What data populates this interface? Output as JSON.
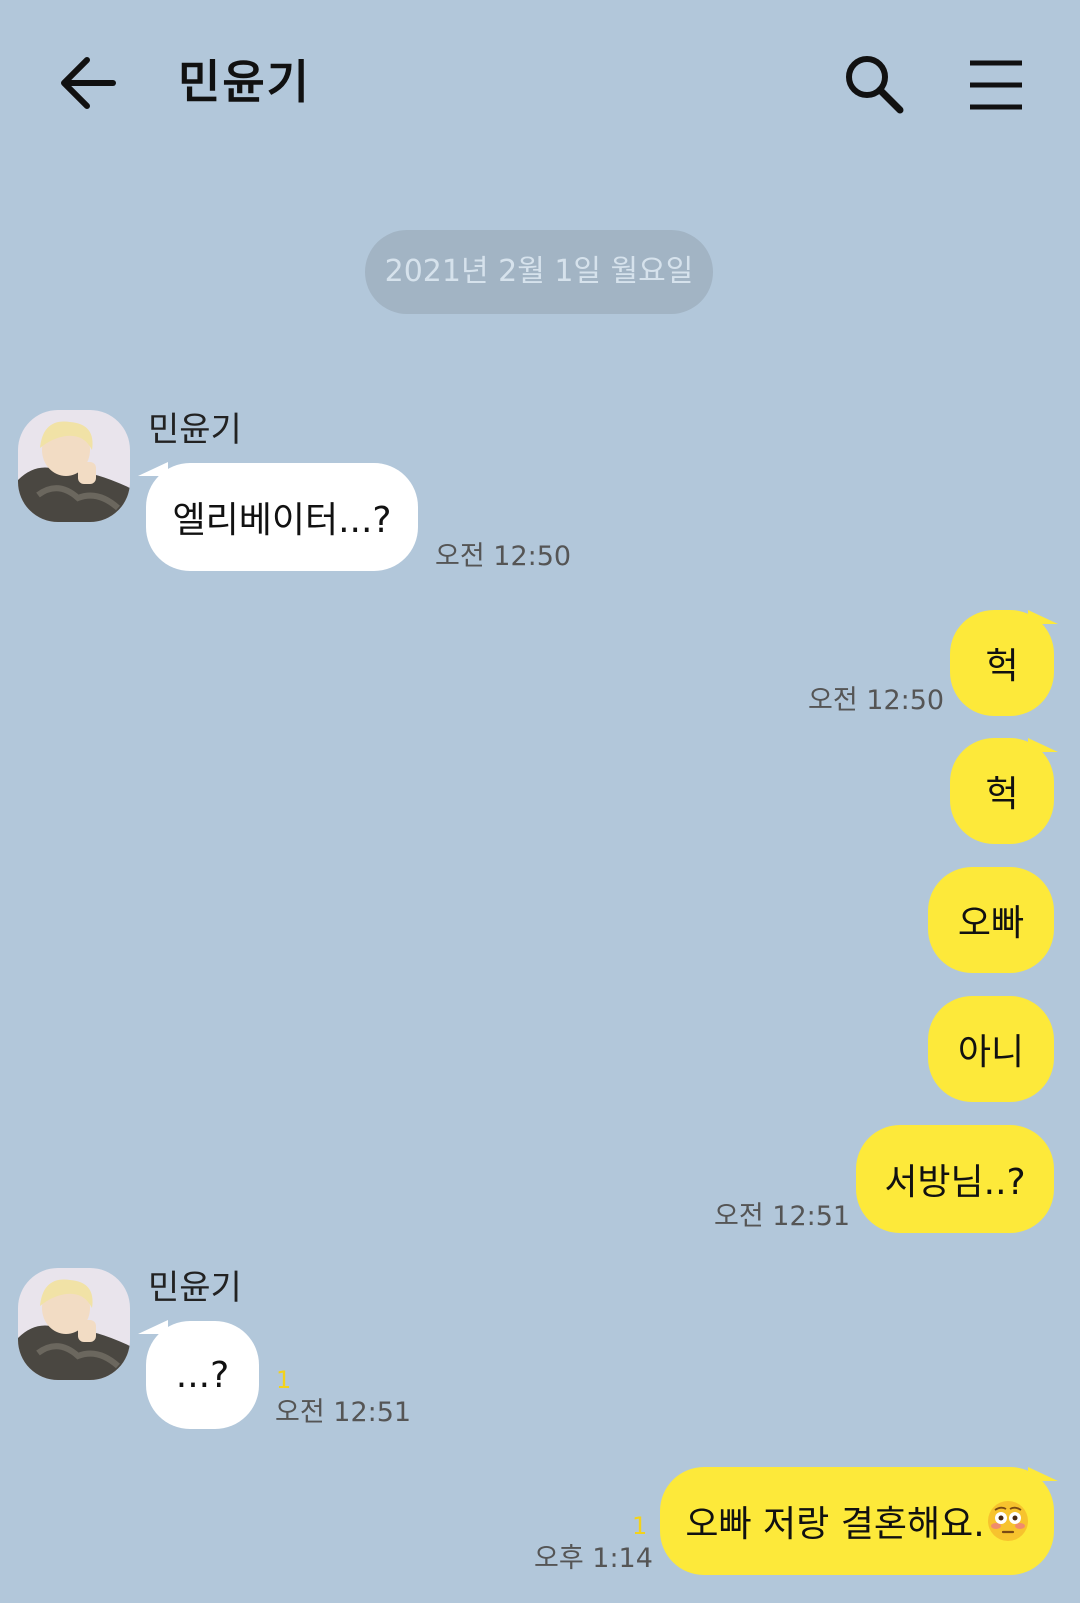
{
  "header": {
    "title": "민윤기",
    "back_icon": "arrow-left-icon",
    "search_icon": "search-icon",
    "menu_icon": "hamburger-menu-icon"
  },
  "date_divider": "2021년 2월 1일 월요일",
  "messages": [
    {
      "from": "them",
      "sender": "민윤기",
      "text": "엘리베이터...?",
      "time": "오전 12:50"
    },
    {
      "from": "me",
      "text": "헉",
      "time": "오전 12:50"
    },
    {
      "from": "me",
      "text": "헉"
    },
    {
      "from": "me",
      "text": "오빠"
    },
    {
      "from": "me",
      "text": "아니"
    },
    {
      "from": "me",
      "text": "서방님..?",
      "time": "오전 12:51"
    },
    {
      "from": "them",
      "sender": "민윤기",
      "text": "...?",
      "unread": "1",
      "time": "오전 12:51"
    },
    {
      "from": "me",
      "text": "오빠 저랑 결혼해요.",
      "emoji": "flushed-face-emoji",
      "unread": "1",
      "time": "오후 1:14"
    }
  ],
  "colors": {
    "background": "#b2c7da",
    "my_bubble": "#fde93a",
    "their_bubble": "#ffffff",
    "date_pill": "#a2b4c4",
    "unread": "#f3d21b"
  }
}
